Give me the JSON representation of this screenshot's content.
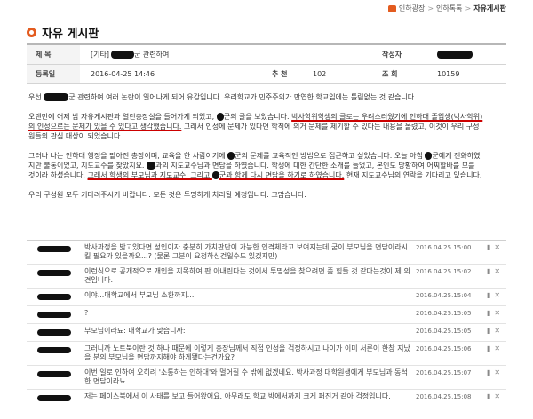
{
  "breadcrumb": {
    "items": [
      "인하광장",
      "인하톡톡",
      "자유게시판"
    ]
  },
  "board": {
    "title": "자유 게시판"
  },
  "post": {
    "subject_label": "제 목",
    "subject_prefix": "[기타]",
    "subject_text": "군 관련하여",
    "author_label": "작성자",
    "date_label": "등록일",
    "date": "2016-04-25 14:46",
    "recommend_label": "추 천",
    "recommend_count": "102",
    "views_label": "조 회",
    "views_count": "10159"
  },
  "body": {
    "p1a": "우선 ",
    "p1b": "군 관련하여 여러 논란이 일어나게 되어 유감입니다. 우리학교가 민주주의가 만연한 학교임에는 틀림없는 것 같습니다.",
    "p2a": "오랜만에 어제 밤 자유게시판과 열린총장실을 들어가게 되었고, ",
    "p2b": "군의 글을 보았습니다. ",
    "p2c": "박사학위학생의 글로는 우려스러웠기에 인하대 졸업생(박사학위)의 인성으로는 문제가 있을 수 있다고 생각했습니다.",
    "p2d": " 그래서 인성에 문제가 있다면 학칙에 의거 문제를 제기할 수 있다는 내용을 올렸고, 이것이 우리 구성원들의 관심 대상이 되었습니다.",
    "p3a": "그러나 나는 인하대 행정을 맡아진 총장이며, 교육을 한 사람이기에 ",
    "p3b": "군의 문제를 교육적인 방법으로 접근하고 싶었습니다. 오늘 아침 ",
    "p3c": "군에게 전화하였지만 불통이었고, 지도교수를 찾았지요. ",
    "p3d": "과의 지도교수님과 면담을 하였습니다. 학생에 대한 간단한 소개를 들었고, 본인도 당황하여 어찌할바를 모를 것이라 하셨습니다. ",
    "p3e": "그래서 학생의 부모님과 지도교수, 그리고 ",
    "p3f": "군과 함께 다시 면담을 하기로 하였습니다.",
    "p3g": " 현재 지도교수님의 연락을 기다리고 있습니다.",
    "p4": "우리 구성원 모두 기다려주시기 바랍니다. 모든 것은 투명하게 처리될 예정입니다. 고맙습니다."
  },
  "comments": [
    {
      "text": "박사과정을 밟고있다면 성인이자 충분히 가치판단이 가능한 인격체라고 보여지는데 굳이 부모님을 면담이라시킬 필요가 있을까요...? (물론 그분이 요청하신건일수도 있겠지만)",
      "date": "2016.04.25.15:00"
    },
    {
      "text": "이런식으로 공개적으로 개인을 지목하여 판 아내린다는 것에서 투명성을 찾으려면 좀 힘들 것 같다는것이 제 의견입니다.",
      "date": "2016.04.25.15:02"
    },
    {
      "text": "이야...대학교에서 부모님 소환까지...",
      "date": "2016.04.25.15:04"
    },
    {
      "text": "?",
      "date": "2016.04.25.15:05"
    },
    {
      "text": "부모님이라뇨: 대학교가 맞습니까:",
      "date": "2016.04.25.15:05"
    },
    {
      "text": "그러니까 노트북이란 것 하나 때문에 이렇게 총장님께서 직접 인성을 걱정하시고 나이가 이미 서른이 한창 지났을 분의 부모님을 면담까지해야 하게됐다는건가요?",
      "date": "2016.04.25.15:06"
    },
    {
      "text": "이번 일로 인하여 오히려 '소통하는 인하대'와 멀어질 수 밖에 없겠네요. 박사과정 대학원생에게 부모님과 동석한 면담이라뇨...",
      "date": "2016.04.25.15:07"
    },
    {
      "text": "저는 페이스북에서 이 사태를 보고 들어왔어요. 아무래도 학교 박에서까지 크게 퍼진거 같아 걱정입니다.",
      "date": "2016.04.25.15:08"
    }
  ]
}
